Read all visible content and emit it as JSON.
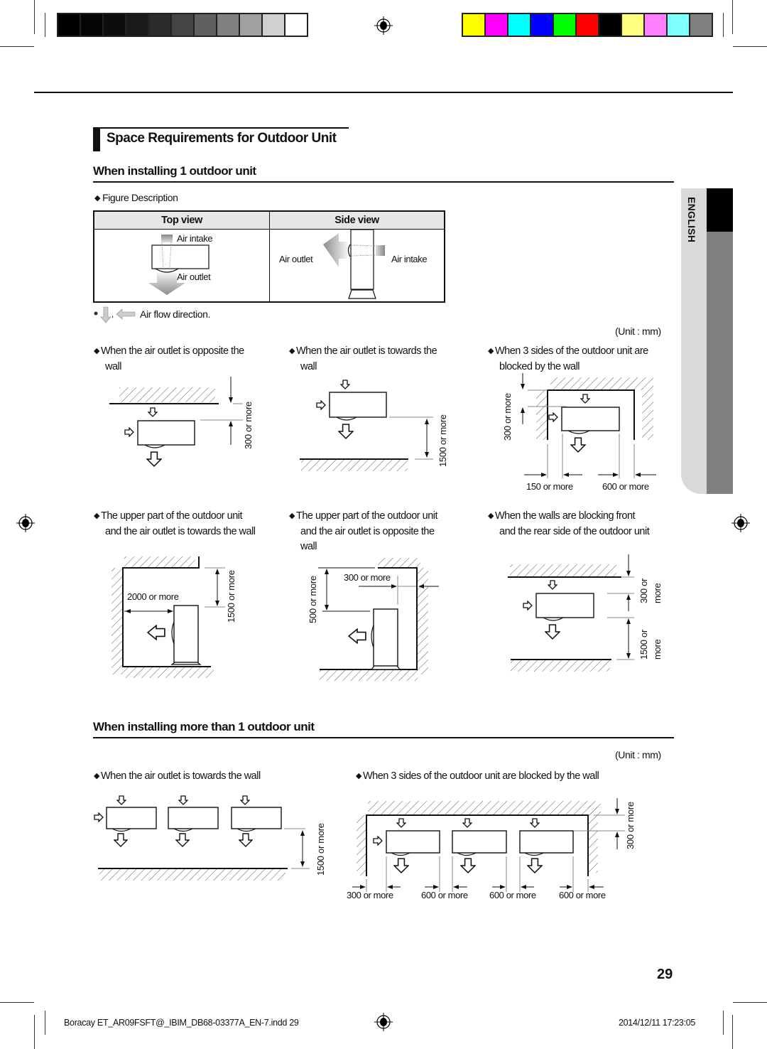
{
  "print_marks": {
    "grayscale_swatches": [
      "#000000",
      "#050505",
      "#0d0d0d",
      "#1a1a1a",
      "#2b2b2b",
      "#444444",
      "#606060",
      "#808080",
      "#a0a0a0",
      "#d0d0d0",
      "#ffffff"
    ],
    "color_swatches": [
      "#ffff00",
      "#ff00ff",
      "#00ffff",
      "#0000ff",
      "#00ff00",
      "#ff0000",
      "#000000",
      "#ffff80",
      "#ff80ff",
      "#80ffff",
      "#808080"
    ]
  },
  "section": {
    "title": "Space Requirements for Outdoor Unit"
  },
  "side_tab": {
    "label": "ENGLISH"
  },
  "single_unit": {
    "heading": "When installing 1 outdoor unit",
    "figure_description": "Figure Description",
    "table": {
      "top_view": {
        "header": "Top view",
        "air_intake": "Air intake",
        "air_outlet": "Air outlet"
      },
      "side_view": {
        "header": "Side view",
        "air_outlet": "Air outlet",
        "air_intake": "Air intake"
      }
    },
    "airflow_note": "Air flow direction.",
    "unit_note": "(Unit : mm)",
    "cases": [
      {
        "line1": "When the air outlet is opposite the",
        "line2": "wall",
        "dims": [
          "300 or more"
        ]
      },
      {
        "line1": "When the air outlet is towards the",
        "line2": "wall",
        "dims": [
          "1500 or more"
        ]
      },
      {
        "line1": "When 3 sides of the outdoor unit are",
        "line2": "blocked by the wall",
        "dims": [
          "300 or more",
          "150 or more",
          "600 or more"
        ]
      },
      {
        "line1": "The upper part of the outdoor unit",
        "line2": "and the air outlet is towards the wall",
        "dims": [
          "2000 or more",
          "1500 or more"
        ]
      },
      {
        "line1": "The upper part of the outdoor unit",
        "line2": "and the air outlet is opposite the",
        "line3": "wall",
        "dims": [
          "300 or more",
          "500 or more"
        ]
      },
      {
        "line1": "When the walls are blocking front",
        "line2": "and the rear side of the outdoor unit",
        "dims": [
          "300 or",
          "more",
          "1500 or",
          "more"
        ]
      }
    ]
  },
  "multi_unit": {
    "heading": "When installing more than 1 outdoor unit",
    "unit_note": "(Unit : mm)",
    "cases": [
      {
        "line1": "When the air outlet is towards the wall",
        "dims": [
          "1500 or more"
        ]
      },
      {
        "line1": "When 3 sides of the outdoor unit are blocked by the wall",
        "dims": [
          "300 or more",
          "300 or more",
          "600 or more",
          "600 or more",
          "600 or more"
        ]
      }
    ]
  },
  "page_number": "29",
  "footer": {
    "file": "Boracay ET_AR09FSFT@_IBIM_DB68-03377A_EN-7.indd   29",
    "timestamp": "2014/12/11   17:23:05"
  }
}
